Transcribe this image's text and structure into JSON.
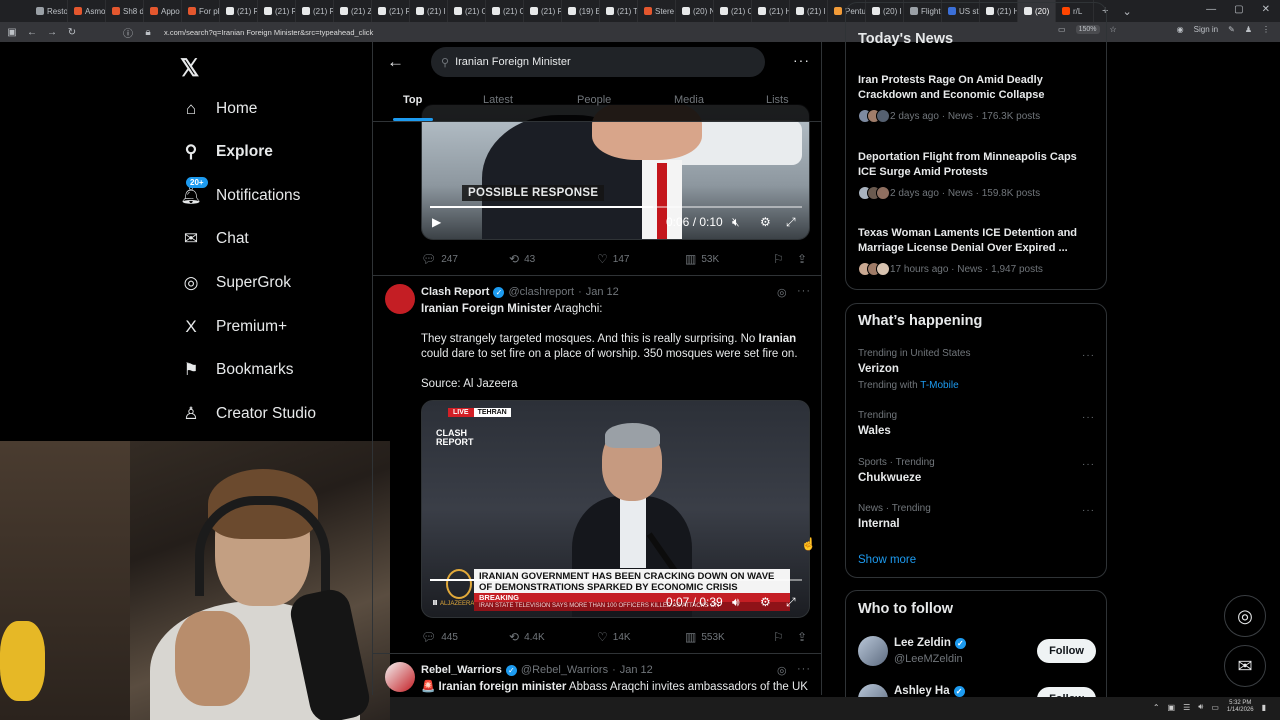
{
  "browser": {
    "tabs": [
      {
        "label": "Resto",
        "color": "#9aa0a6"
      },
      {
        "label": "Asmo",
        "color": "#e4572e"
      },
      {
        "label": "Sh8 d",
        "color": "#e4572e"
      },
      {
        "label": "Appo",
        "color": "#e4572e"
      },
      {
        "label": "For pl",
        "color": "#e4572e"
      },
      {
        "label": "(21) R",
        "color": "#e7e9ea"
      },
      {
        "label": "(21) R",
        "color": "#e7e9ea"
      },
      {
        "label": "(21) R",
        "color": "#e7e9ea"
      },
      {
        "label": "(21) Z",
        "color": "#e7e9ea"
      },
      {
        "label": "(21) R",
        "color": "#e7e9ea"
      },
      {
        "label": "(21) I",
        "color": "#e7e9ea"
      },
      {
        "label": "(21) O",
        "color": "#e7e9ea"
      },
      {
        "label": "(21) O",
        "color": "#e7e9ea"
      },
      {
        "label": "(21) R",
        "color": "#e7e9ea"
      },
      {
        "label": "(19) E",
        "color": "#e7e9ea"
      },
      {
        "label": "(21) T",
        "color": "#e7e9ea"
      },
      {
        "label": "Stere",
        "color": "#e4572e"
      },
      {
        "label": "(20) N",
        "color": "#e7e9ea"
      },
      {
        "label": "(21) O",
        "color": "#e7e9ea"
      },
      {
        "label": "(21) H",
        "color": "#e7e9ea"
      },
      {
        "label": "(21) I",
        "color": "#e7e9ea"
      },
      {
        "label": "Pentu",
        "color": "#f29b38"
      },
      {
        "label": "(20) I",
        "color": "#e7e9ea"
      },
      {
        "label": "Flight",
        "color": "#9aa0a6"
      },
      {
        "label": "US st",
        "color": "#3b6fd8"
      },
      {
        "label": "(21) H",
        "color": "#e7e9ea"
      },
      {
        "label": "(20)",
        "color": "#e7e9ea",
        "active": true
      },
      {
        "label": "r/L",
        "color": "#ff4500"
      }
    ],
    "tab_new": "+",
    "tab_list": "⌄",
    "url": "x.com/search?q=Iranian Foreign Minister&src=typeahead_click",
    "zoom": "150%",
    "sign_in": "Sign in"
  },
  "nav": {
    "items": [
      {
        "label": "Home",
        "icon": "⌂"
      },
      {
        "label": "Explore",
        "icon": "⚲"
      },
      {
        "label": "Notifications",
        "icon": "🔔",
        "badge": "20+"
      },
      {
        "label": "Chat",
        "icon": "✉"
      },
      {
        "label": "SuperGrok",
        "icon": "◎"
      },
      {
        "label": "Premium+",
        "icon": "X"
      },
      {
        "label": "Bookmarks",
        "icon": "🔖"
      },
      {
        "label": "Creator Studio",
        "icon": "♙"
      }
    ]
  },
  "search": {
    "query": "Iranian Foreign Minister",
    "tabs": [
      "Top",
      "Latest",
      "People",
      "Media",
      "Lists"
    ]
  },
  "video1": {
    "caption": "POSSIBLE RESPONSE",
    "time": "0:06 / 0:10",
    "progress": 0.6
  },
  "tweet0_actions": {
    "replies": "247",
    "reposts": "43",
    "likes": "147",
    "views": "53K"
  },
  "tweet1": {
    "name": "Clash Report",
    "handle": "@clashreport",
    "date": "Jan 12",
    "line1_bold": "Iranian Foreign Minister",
    "line1_rest": " Araghchi:",
    "para2_a": "They strangely targeted mosques. And this is really surprising. No ",
    "para2_bold": "Iranian",
    "para2_b": " could dare to set fire on a place of worship. 350 mosques were set fire on.",
    "source": "Source: Al Jazeera",
    "video": {
      "live": "LIVE",
      "location": "TEHRAN",
      "logo": "CLASH REPORT",
      "headline": "IRANIAN GOVERNMENT HAS BEEN CRACKING DOWN ON WAVE OF DEMONSTRATIONS SPARKED BY ECONOMIC CRISIS",
      "breaking": "BREAKING",
      "ticker": "IRAN STATE TELEVISION SAYS MORE THAN 100 OFFICERS KILLED AS ATTACKS ON",
      "network": "ALJAZEERA",
      "time": "0:07 / 0:39",
      "progress": 0.18
    },
    "actions": {
      "replies": "445",
      "reposts": "4.4K",
      "likes": "14K",
      "views": "553K"
    }
  },
  "tweet2": {
    "name": "Rebel_Warriors",
    "handle": "@Rebel_Warriors",
    "date": "Jan 12",
    "flag": "🚨",
    "bold": "Iranian foreign minister",
    "rest": " Abbass Araqchi invites ambassadors of the UK"
  },
  "news": {
    "title": "Today's News",
    "items": [
      {
        "title": "Iran Protests Rage On Amid Deadly Crackdown and Economic Collapse",
        "meta": "2 days ago · News · 176.3K posts"
      },
      {
        "title": "Deportation Flight from Minneapolis Caps ICE Surge Amid Protests",
        "meta": "2 days ago · News · 159.8K posts"
      },
      {
        "title": "Texas Woman Laments ICE Detention and Marriage License Denial Over Expired ...",
        "meta": "17 hours ago · News · 1,947 posts"
      }
    ]
  },
  "happening": {
    "title": "What’s happening",
    "trends": [
      {
        "context": "Trending in United States",
        "name": "Verizon",
        "with": "Trending with",
        "with_link": "T-Mobile"
      },
      {
        "context": "Trending",
        "name": "Wales"
      },
      {
        "context": "Sports · Trending",
        "name": "Chukwueze"
      },
      {
        "context": "News · Trending",
        "name": "Internal"
      }
    ],
    "show_more": "Show more"
  },
  "who_to_follow": {
    "title": "Who to follow",
    "users": [
      {
        "name": "Lee Zeldin",
        "handle": "@LeeMZeldin",
        "button": "Follow"
      },
      {
        "name": "Ashley Ha",
        "handle": "",
        "button": "Follow"
      }
    ]
  },
  "taskbar": {
    "time": "5:32 PM",
    "date": "1/14/2026"
  },
  "colors": {
    "accent": "#1d9bf0",
    "background": "#000000",
    "border": "#2f3336"
  }
}
